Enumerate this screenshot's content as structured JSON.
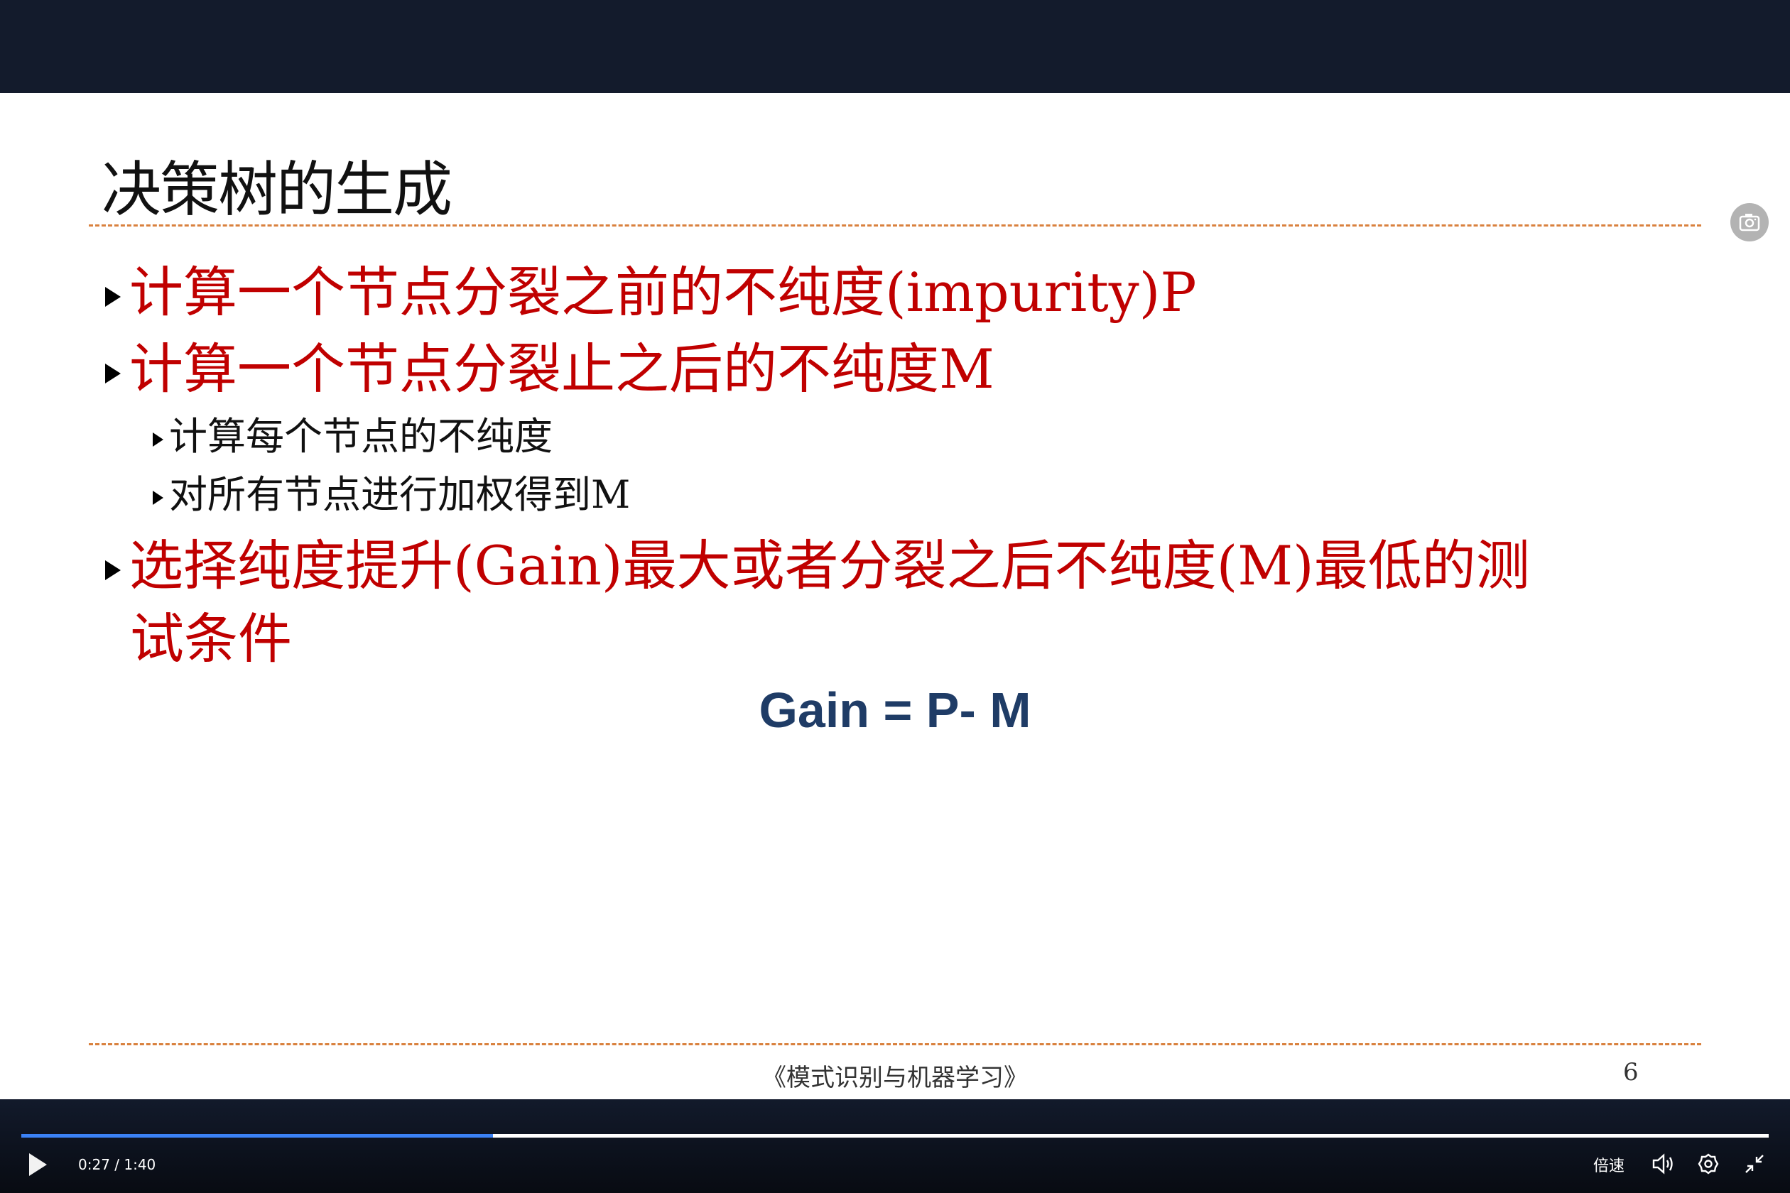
{
  "slide": {
    "title": "决策树的生成",
    "bullets": [
      "计算一个节点分裂之前的不纯度(impurity)P",
      "计算一个节点分裂止之后的不纯度M"
    ],
    "sub_bullets": [
      "计算每个节点的不纯度",
      "对所有节点进行加权得到M"
    ],
    "bullet3_line1": "选择纯度提升(Gain)最大或者分裂之后不纯度(M)最低的测",
    "bullet3_line2": "试条件",
    "formula": "Gain = P- M",
    "footer": "《模式识别与机器学习》",
    "page_number": "6"
  },
  "player": {
    "time": "0:27 / 1:40",
    "progress_fraction": 0.27,
    "speed_label": "倍速",
    "accent": "#3b82f6",
    "icons": [
      "play-icon",
      "volume-icon",
      "settings-icon",
      "exit-fullscreen-icon",
      "camera-icon"
    ]
  }
}
